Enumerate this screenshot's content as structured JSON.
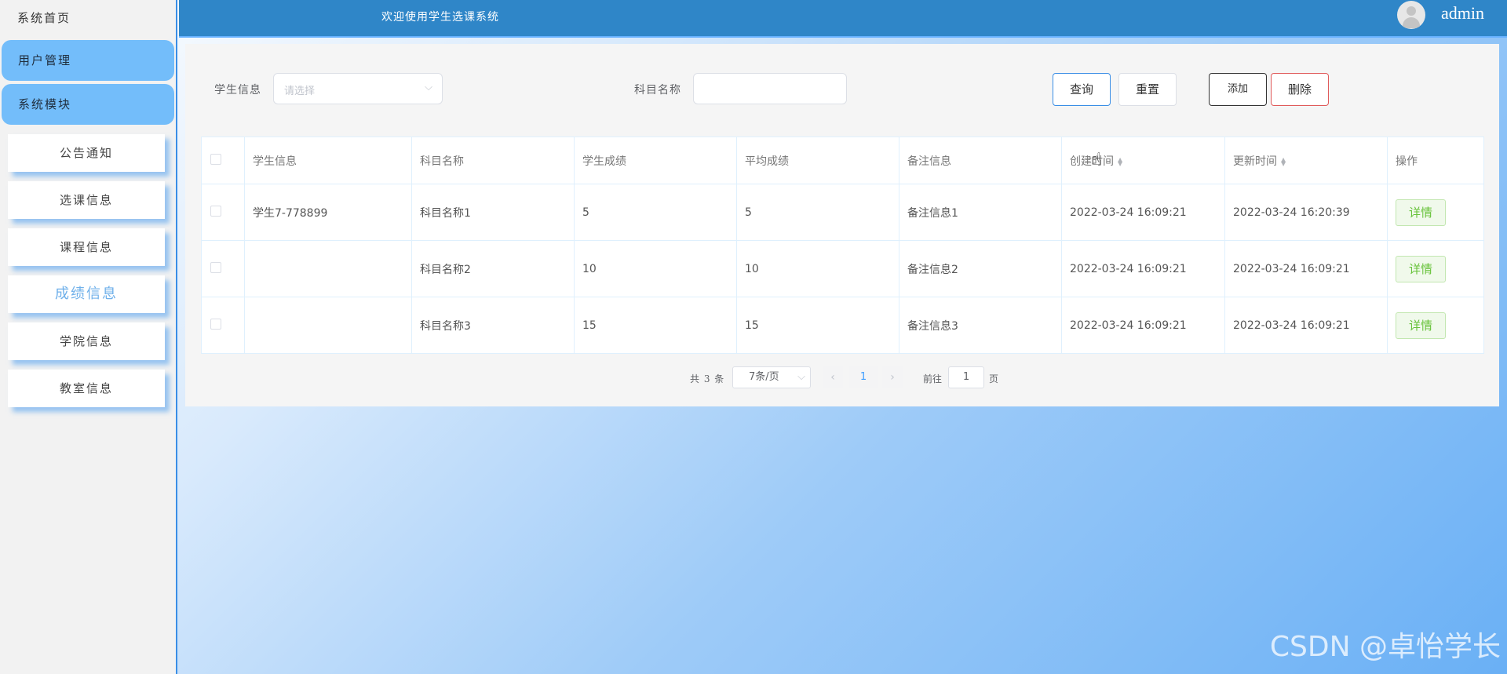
{
  "sidebar": {
    "home": "系统首页",
    "groups": [
      "用户管理",
      "系统模块"
    ],
    "items": [
      "公告通知",
      "选课信息",
      "课程信息",
      "成绩信息",
      "学院信息",
      "教室信息"
    ],
    "active_item": "成绩信息"
  },
  "header": {
    "welcome": "欢迎使用学生选课系统",
    "username": "admin"
  },
  "search": {
    "student_label": "学生信息",
    "student_placeholder": "请选择",
    "subject_label": "科目名称",
    "subject_value": ""
  },
  "toolbar": {
    "query": "查询",
    "reset": "重置",
    "add": "添加",
    "delete": "删除"
  },
  "table": {
    "columns": [
      "学生信息",
      "科目名称",
      "学生成绩",
      "平均成绩",
      "备注信息",
      "创建时间",
      "更新时间",
      "操作"
    ],
    "rows": [
      [
        "学生7-778899",
        "科目名称1",
        "5",
        "5",
        "备注信息1",
        "2022-03-24 16:09:21",
        "2022-03-24 16:20:39",
        "详情"
      ],
      [
        "",
        "科目名称2",
        "10",
        "10",
        "备注信息2",
        "2022-03-24 16:09:21",
        "2022-03-24 16:09:21",
        "详情"
      ],
      [
        "",
        "科目名称3",
        "15",
        "15",
        "备注信息3",
        "2022-03-24 16:09:21",
        "2022-03-24 16:09:21",
        "详情"
      ]
    ]
  },
  "pagination": {
    "total": "共 3 条",
    "page_size": "7条/页",
    "current_page": "1",
    "goto_prefix": "前往",
    "goto_value": "1",
    "goto_suffix": "页"
  },
  "watermark": "CSDN @卓怡学长",
  "colors": {
    "header": "#2f86c8",
    "sidebar_group": "#73bdfa",
    "active_item": "#6fb0ea",
    "detail_button": "#67c23a"
  }
}
